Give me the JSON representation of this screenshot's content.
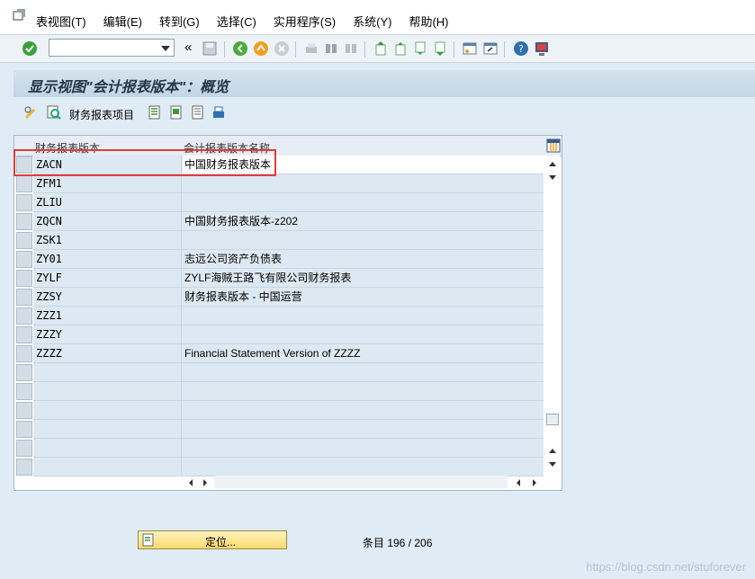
{
  "menubar": {
    "items": [
      "表视图(T)",
      "编辑(E)",
      "转到(G)",
      "选择(C)",
      "实用程序(S)",
      "系统(Y)",
      "帮助(H)"
    ]
  },
  "toolbar": {
    "command_value": "",
    "nav_symbol": "«"
  },
  "page": {
    "title": "显示视图\"会计报表版本\"：概览"
  },
  "app_toolbar": {
    "fin_items_label": "财务报表项目"
  },
  "table": {
    "headers": [
      "财务报表版本",
      "会计报表版本名称"
    ],
    "rows": [
      [
        "ZACN",
        "中国财务报表版本"
      ],
      [
        "ZFM1",
        ""
      ],
      [
        "ZLIU",
        ""
      ],
      [
        "ZQCN",
        "中国财务报表版本-z202"
      ],
      [
        "ZSK1",
        ""
      ],
      [
        "ZY01",
        "志远公司资产负债表"
      ],
      [
        "ZYLF",
        "ZYLF海贼王路飞有限公司财务报表"
      ],
      [
        "ZZSY",
        "财务报表版本 - 中国运营"
      ],
      [
        "ZZZ1",
        ""
      ],
      [
        "ZZZY",
        ""
      ],
      [
        "ZZZZ",
        "Financial Statement Version of ZZZZ"
      ]
    ]
  },
  "footer": {
    "locate_label": "定位...",
    "entry_count": "条目 196 / 206"
  },
  "watermark": "https://blog.csdn.net/stuforever"
}
